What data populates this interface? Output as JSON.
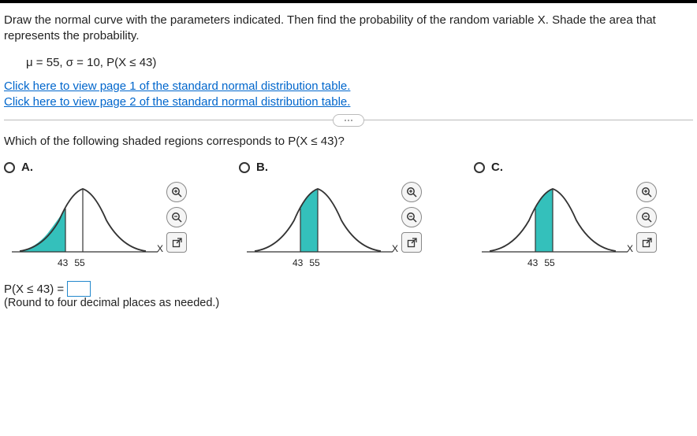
{
  "instruction": "Draw the normal curve with the parameters indicated. Then find the probability of the random variable X. Shade the area that represents the probability.",
  "parameters": "μ = 55, σ = 10, P(X ≤ 43)",
  "links": {
    "page1": "Click here to view page 1 of the standard normal distribution table.",
    "page2": "Click here to view page 2 of the standard normal distribution table."
  },
  "question": "Which of the following shaded regions corresponds to P(X ≤ 43)?",
  "options": {
    "a": {
      "label": "A.",
      "tick1": "43",
      "tick2": "55",
      "axis": "X"
    },
    "b": {
      "label": "B.",
      "tick1": "43",
      "tick2": "55",
      "axis": "X"
    },
    "c": {
      "label": "C.",
      "tick1": "43",
      "tick2": "55",
      "axis": "X"
    }
  },
  "answer": {
    "prefix": "P(X ≤ 43) =",
    "value": "",
    "hint": "(Round to four decimal places as needed.)"
  },
  "chart_data": [
    {
      "type": "area",
      "title": "Option A",
      "distribution": "normal",
      "mu": 55,
      "sigma": 10,
      "shaded_region": [
        null,
        43
      ],
      "x_ticks": [
        43,
        55
      ],
      "xlabel": "X"
    },
    {
      "type": "area",
      "title": "Option B",
      "distribution": "normal",
      "mu": 55,
      "sigma": 10,
      "shaded_region": [
        43,
        55
      ],
      "x_ticks": [
        43,
        55
      ],
      "xlabel": "X"
    },
    {
      "type": "area",
      "title": "Option C",
      "distribution": "normal",
      "mu": 55,
      "sigma": 10,
      "shaded_region": [
        43,
        55
      ],
      "x_ticks": [
        43,
        55
      ],
      "xlabel": "X"
    }
  ]
}
